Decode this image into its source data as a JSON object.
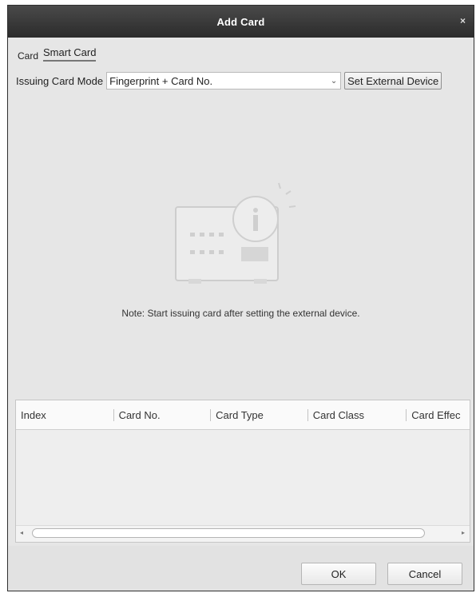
{
  "window": {
    "title": "Add Card",
    "close_glyph": "×"
  },
  "tabs": [
    {
      "label": "Card",
      "active": false
    },
    {
      "label": "Smart Card",
      "active": true
    }
  ],
  "issuing": {
    "label": "Issuing Card Mode",
    "selected": "Fingerprint + Card No.",
    "arrow_glyph": "⌄",
    "external_button": "Set External Device"
  },
  "note": "Note: Start issuing card after setting the external device.",
  "table": {
    "columns": [
      "Index",
      "Card No.",
      "Card Type",
      "Card Class",
      "Card Effec"
    ],
    "rows": []
  },
  "footer": {
    "ok": "OK",
    "cancel": "Cancel"
  },
  "icons": {
    "illustration": "card-reader-info-icon"
  }
}
